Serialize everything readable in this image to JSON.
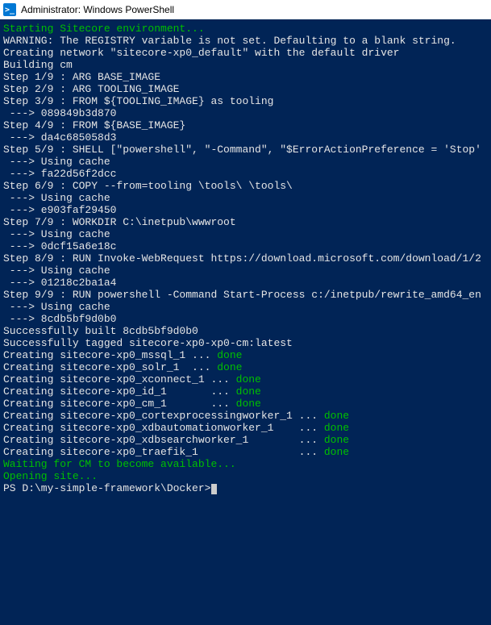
{
  "titlebar": {
    "icon_label": ">_",
    "title": "Administrator: Windows PowerShell"
  },
  "lines": [
    {
      "text": "Starting Sitecore environment...",
      "cls": "green"
    },
    {
      "text": "WARNING: The REGISTRY variable is not set. Defaulting to a blank string."
    },
    {
      "text": "Creating network \"sitecore-xp0_default\" with the default driver"
    },
    {
      "text": "Building cm"
    },
    {
      "text": "Step 1/9 : ARG BASE_IMAGE"
    },
    {
      "text": "Step 2/9 : ARG TOOLING_IMAGE"
    },
    {
      "text": "Step 3/9 : FROM ${TOOLING_IMAGE} as tooling"
    },
    {
      "text": " ---> 089849b3d870"
    },
    {
      "text": ""
    },
    {
      "text": "Step 4/9 : FROM ${BASE_IMAGE}"
    },
    {
      "text": " ---> da4c685058d3"
    },
    {
      "text": "Step 5/9 : SHELL [\"powershell\", \"-Command\", \"$ErrorActionPreference = 'Stop'"
    },
    {
      "text": " ---> Using cache"
    },
    {
      "text": " ---> fa22d56f2dcc"
    },
    {
      "text": "Step 6/9 : COPY --from=tooling \\tools\\ \\tools\\"
    },
    {
      "text": " ---> Using cache"
    },
    {
      "text": " ---> e903faf29450"
    },
    {
      "text": "Step 7/9 : WORKDIR C:\\inetpub\\wwwroot"
    },
    {
      "text": " ---> Using cache"
    },
    {
      "text": " ---> 0dcf15a6e18c"
    },
    {
      "text": "Step 8/9 : RUN Invoke-WebRequest https://download.microsoft.com/download/1/2"
    },
    {
      "text": " ---> Using cache"
    },
    {
      "text": " ---> 01218c2ba1a4"
    },
    {
      "text": "Step 9/9 : RUN powershell -Command Start-Process c:/inetpub/rewrite_amd64_en"
    },
    {
      "text": " ---> Using cache"
    },
    {
      "text": " ---> 8cdb5bf9d0b0"
    },
    {
      "text": ""
    },
    {
      "text": "Successfully built 8cdb5bf9d0b0"
    },
    {
      "text": "Successfully tagged sitecore-xp0-xp0-cm:latest"
    },
    {
      "segments": [
        {
          "t": "Creating sitecore-xp0_mssql_1 ... "
        },
        {
          "t": "done",
          "cls": "green"
        }
      ]
    },
    {
      "segments": [
        {
          "t": "Creating sitecore-xp0_solr_1  ... "
        },
        {
          "t": "done",
          "cls": "green"
        }
      ]
    },
    {
      "segments": [
        {
          "t": "Creating sitecore-xp0_xconnect_1 ... "
        },
        {
          "t": "done",
          "cls": "green"
        }
      ]
    },
    {
      "segments": [
        {
          "t": "Creating sitecore-xp0_id_1       ... "
        },
        {
          "t": "done",
          "cls": "green"
        }
      ]
    },
    {
      "segments": [
        {
          "t": "Creating sitecore-xp0_cm_1       ... "
        },
        {
          "t": "done",
          "cls": "green"
        }
      ]
    },
    {
      "segments": [
        {
          "t": "Creating sitecore-xp0_cortexprocessingworker_1 ... "
        },
        {
          "t": "done",
          "cls": "green"
        }
      ]
    },
    {
      "segments": [
        {
          "t": "Creating sitecore-xp0_xdbautomationworker_1    ... "
        },
        {
          "t": "done",
          "cls": "green"
        }
      ]
    },
    {
      "segments": [
        {
          "t": "Creating sitecore-xp0_xdbsearchworker_1        ... "
        },
        {
          "t": "done",
          "cls": "green"
        }
      ]
    },
    {
      "segments": [
        {
          "t": "Creating sitecore-xp0_traefik_1                ... "
        },
        {
          "t": "done",
          "cls": "green"
        }
      ]
    },
    {
      "text": "Waiting for CM to become available...",
      "cls": "green"
    },
    {
      "text": "Opening site...",
      "cls": "green"
    }
  ],
  "prompt": "PS D:\\my-simple-framework\\Docker>"
}
